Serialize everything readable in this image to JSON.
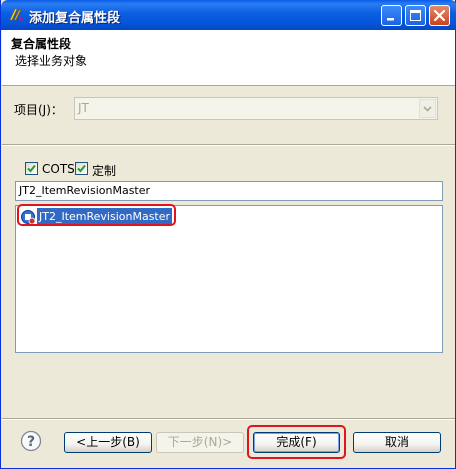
{
  "window": {
    "title": "添加复合属性段",
    "app_icon": "eclipse-wizard-icon",
    "controls": [
      "minimize-icon",
      "maximize-icon",
      "close-icon"
    ]
  },
  "header": {
    "title": "复合属性段",
    "description": "选择业务对象"
  },
  "project": {
    "label": "项目(J)：",
    "value": "JT",
    "disabled": true
  },
  "filters": [
    {
      "label": "COTS",
      "checked": true
    },
    {
      "label": "定制",
      "checked": true
    }
  ],
  "search": {
    "value": "JT2_ItemRevisionMaster"
  },
  "list": {
    "items": [
      {
        "label": "JT2_ItemRevisionMaster",
        "selected": true,
        "icon": "business-object-icon"
      }
    ]
  },
  "buttons": {
    "back": "<上一步(B)",
    "next": "下一步(N)>",
    "finish": "完成(F)",
    "cancel": "取消"
  },
  "colors": {
    "title_bar": "#0553d7",
    "selection": "#316ac5",
    "highlight_outline": "#e0141e"
  }
}
